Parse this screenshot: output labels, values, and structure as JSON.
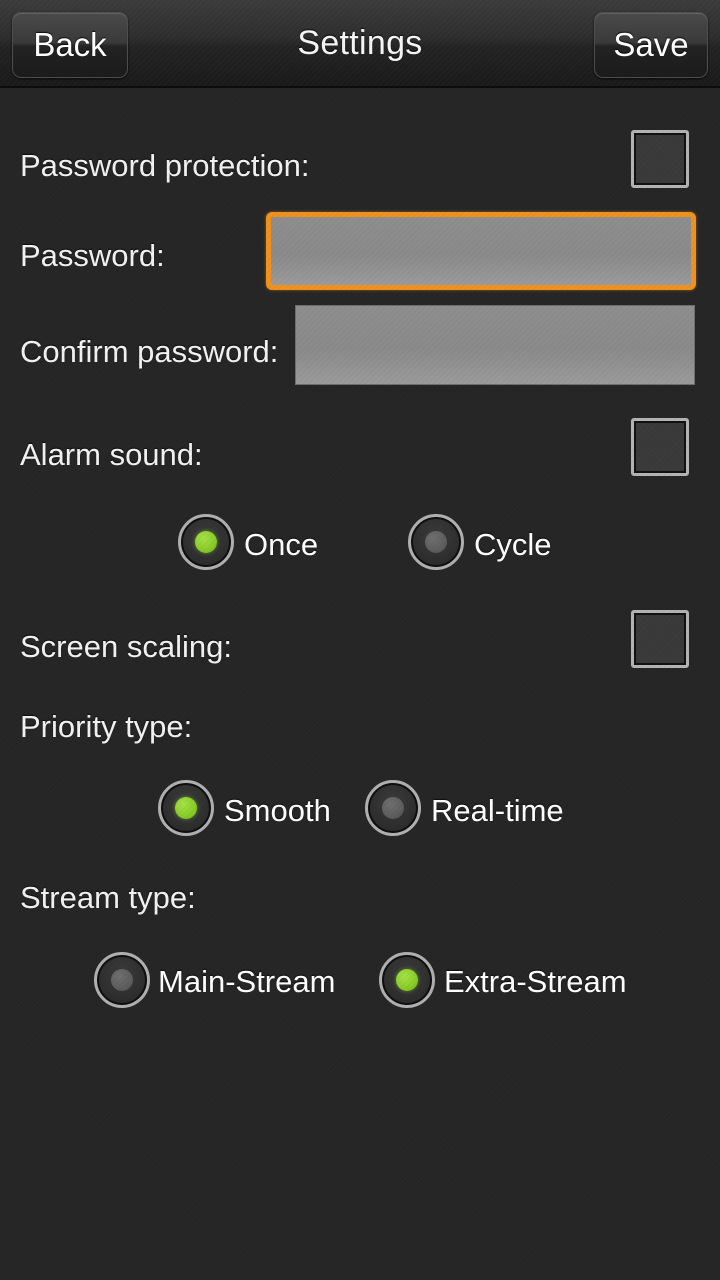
{
  "header": {
    "title": "Settings",
    "back_label": "Back",
    "save_label": "Save"
  },
  "colors": {
    "background": "#262626",
    "header_top": "#3b3b3b",
    "accent_focus": "#f0921e",
    "radio_selected": "#8bcf2a",
    "field_fill": "#8e8e8e",
    "text": "#f2f2f2"
  },
  "form": {
    "password_protection": {
      "label": "Password protection:",
      "checked": false
    },
    "password": {
      "label": "Password:",
      "value": "",
      "placeholder": "",
      "focused": true
    },
    "confirm_password": {
      "label": "Confirm password:",
      "value": "",
      "placeholder": "",
      "focused": false
    },
    "alarm_sound": {
      "label": "Alarm sound:",
      "checked": false,
      "options": [
        {
          "label": "Once",
          "selected": true
        },
        {
          "label": "Cycle",
          "selected": false
        }
      ]
    },
    "screen_scaling": {
      "label": "Screen scaling:",
      "checked": false
    },
    "priority_type": {
      "label": "Priority type:",
      "options": [
        {
          "label": "Smooth",
          "selected": true
        },
        {
          "label": "Real-time",
          "selected": false
        }
      ]
    },
    "stream_type": {
      "label": "Stream type:",
      "options": [
        {
          "label": "Main-Stream",
          "selected": false
        },
        {
          "label": "Extra-Stream",
          "selected": true
        }
      ]
    }
  }
}
